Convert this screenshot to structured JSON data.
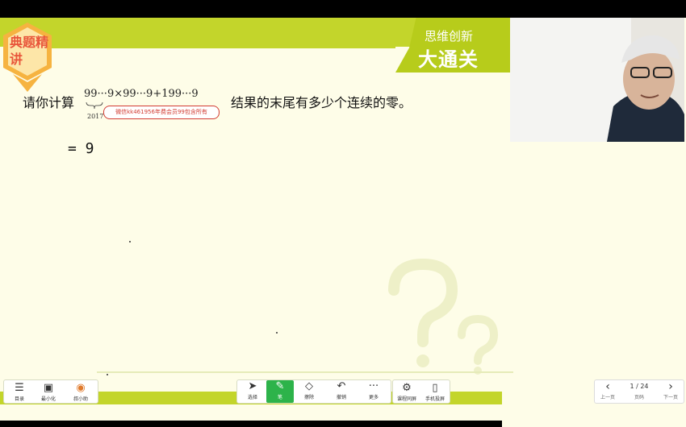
{
  "header": {
    "badge": "典题精讲",
    "brand_small": "思维创新",
    "brand_big": "大通关"
  },
  "question": {
    "prefix": "请你计算",
    "expression": "99···9×99···9+199···9",
    "subscript": "2017",
    "stamp": "微信kk461956年费会员99包含所有",
    "suffix": "结果的末尾有多少个连续的零。"
  },
  "work": {
    "line1": "= 9"
  },
  "toolbar": {
    "left": [
      {
        "icon": "menu-icon",
        "label": "目录"
      },
      {
        "icon": "minimize-icon",
        "label": "最小化"
      },
      {
        "icon": "assistant-icon",
        "label": "叔小助"
      }
    ],
    "center": [
      {
        "icon": "cursor-icon",
        "label": "选择",
        "active": false
      },
      {
        "icon": "pen-icon",
        "label": "笔",
        "active": true
      },
      {
        "icon": "eraser-icon",
        "label": "擦除",
        "active": false
      },
      {
        "icon": "undo-icon",
        "label": "撤销",
        "active": false
      },
      {
        "icon": "more-icon",
        "label": "更多",
        "active": false
      }
    ],
    "right": [
      {
        "icon": "sync-icon",
        "label": "课程同屏"
      },
      {
        "icon": "phone-icon",
        "label": "手机投屏"
      }
    ]
  },
  "pager": {
    "prev_label": "上一页",
    "page_indicator": "1 / 24",
    "page_label": "页码",
    "next_label": "下一页"
  },
  "colors": {
    "accent_green": "#c3d52b",
    "active_green": "#2db34a",
    "badge_orange": "#f6b340",
    "background": "#fefde8"
  }
}
